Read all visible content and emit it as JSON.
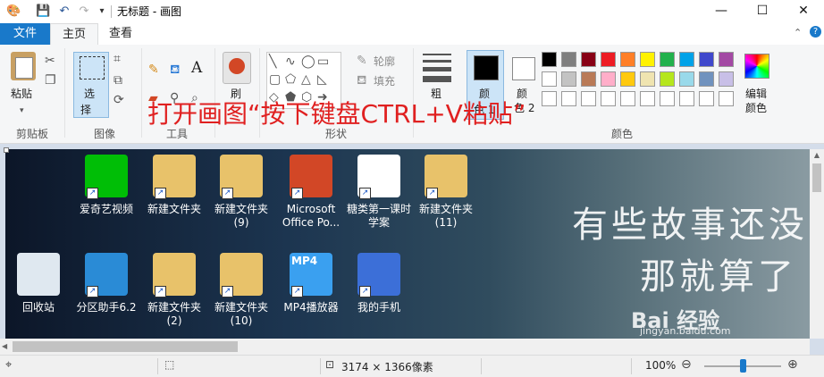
{
  "titlebar": {
    "title": "无标题 - 画图",
    "minimize": "—",
    "maximize": "☐",
    "close": "✕"
  },
  "tabs": {
    "file": "文件",
    "home": "主页",
    "view": "查看"
  },
  "ribbon": {
    "clipboard": {
      "paste": "粘贴",
      "group": "剪贴板"
    },
    "image": {
      "select": "选",
      "select2": "择",
      "group": "图像"
    },
    "tools": {
      "group": "工具"
    },
    "brushes": {
      "label": "刷"
    },
    "shapes": {
      "outline": "轮廓",
      "fill": "填充",
      "group": "形状"
    },
    "size": {
      "label": "粗"
    },
    "color1": {
      "label": "颜",
      "label2": "色 1"
    },
    "color2": {
      "label": "颜",
      "label2": "色 2"
    },
    "colors_group": "颜色",
    "edit_colors": {
      "label1": "编辑",
      "label2": "颜色"
    },
    "palette": [
      "#000000",
      "#7f7f7f",
      "#880015",
      "#ed1c24",
      "#ff7f27",
      "#fff200",
      "#22b14c",
      "#00a2e8",
      "#3f48cc",
      "#a349a4",
      "#ffffff",
      "#c3c3c3",
      "#b97a57",
      "#ffaec9",
      "#ffc90e",
      "#efe4b0",
      "#b5e61d",
      "#99d9ea",
      "#7092be",
      "#c8bfe7",
      "#ffffff",
      "#ffffff",
      "#ffffff",
      "#ffffff",
      "#ffffff",
      "#ffffff",
      "#ffffff",
      "#ffffff",
      "#ffffff",
      "#ffffff"
    ]
  },
  "overlay_text": "打开画图“按下键盘CTRL+V粘贴”",
  "desktop": {
    "row1": [
      {
        "label": "爱奇艺视频",
        "label2": "",
        "color": "#00be06"
      },
      {
        "label": "新建文件夹",
        "label2": "",
        "color": "#e8c26a"
      },
      {
        "label": "新建文件夹",
        "label2": "(9)",
        "color": "#e8c26a"
      },
      {
        "label": "Microsoft",
        "label2": "Office Po...",
        "color": "#d24726"
      },
      {
        "label": "糖类第一课时",
        "label2": "学案",
        "color": "#ffffff"
      },
      {
        "label": "新建文件夹",
        "label2": "(11)",
        "color": "#e8c26a"
      }
    ],
    "row2": [
      {
        "label": "回收站",
        "label2": "",
        "color": "#dfe8f0"
      },
      {
        "label": "分区助手6.2",
        "label2": "",
        "color": "#2a8bd6"
      },
      {
        "label": "新建文件夹",
        "label2": "(2)",
        "color": "#e8c26a"
      },
      {
        "label": "新建文件夹",
        "label2": "(10)",
        "color": "#e8c26a"
      },
      {
        "label": "MP4播放器",
        "label2": "",
        "color": "#3aa0f0"
      },
      {
        "label": "我的手机",
        "label2": "",
        "color": "#3c6fd8"
      }
    ],
    "mp4_badge": "MP4",
    "bigtext1": "有些故事还没",
    "bigtext2": "那就算了",
    "watermark": "Bai 经验",
    "watermark_url": "jingyan.baidu.com"
  },
  "status": {
    "dimensions": "3174 × 1366像素",
    "zoom": "100%",
    "zoom_minus": "⊖",
    "zoom_plus": "⊕",
    "zoom_level": 0.5
  }
}
